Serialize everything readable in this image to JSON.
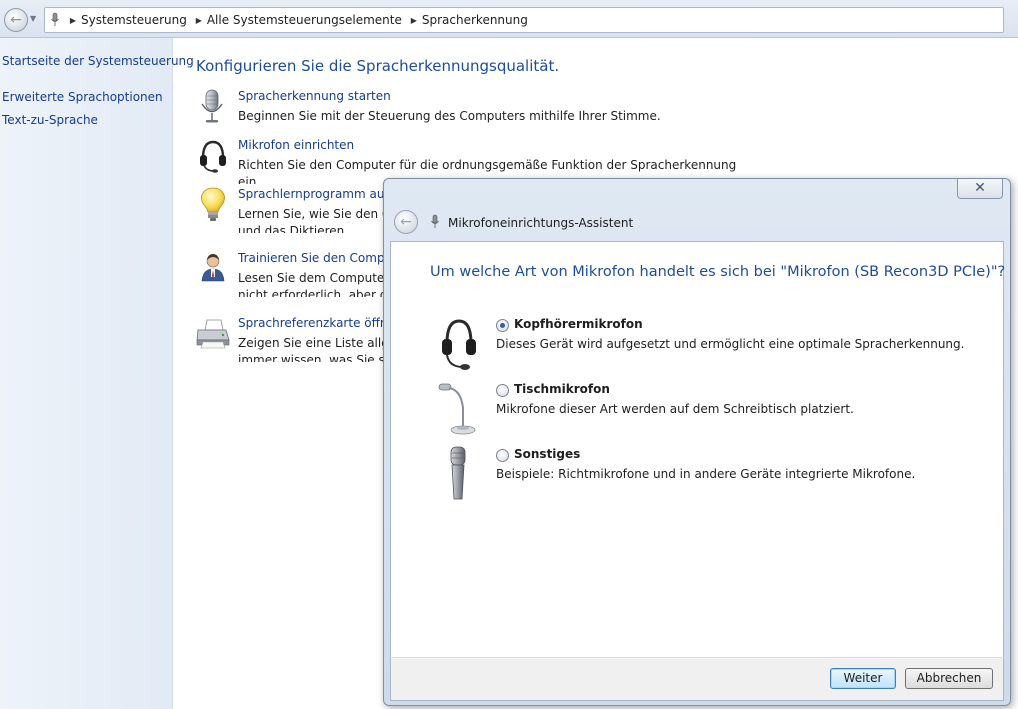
{
  "address_bar": {
    "crumbs": [
      "Systemsteuerung",
      "Alle Systemsteuerungselemente",
      "Spracherkennung"
    ]
  },
  "left_pane": {
    "home_link": "Startseite der Systemsteuerung",
    "links": [
      "Erweiterte Sprachoptionen",
      "Text-zu-Sprache"
    ]
  },
  "main": {
    "title": "Konfigurieren Sie die Spracherkennungsqualität.",
    "tasks": [
      {
        "link": "Spracherkennung starten",
        "desc": "Beginnen Sie mit der Steuerung des Computers mithilfe Ihrer Stimme."
      },
      {
        "link": "Mikrofon einrichten",
        "desc": "Richten Sie den Computer für die ordnungsgemäße Funktion der Spracherkennung ein."
      },
      {
        "link": "Sprachlernprogramm ausfü",
        "desc_line1": "Lernen Sie, wie Sie den Com",
        "desc_line2": "und das Diktieren."
      },
      {
        "link": "Trainieren Sie den Compute",
        "desc_line1": "Lesen Sie dem Computer Te",
        "desc_line2": "nicht erforderlich, aber die C"
      },
      {
        "link": "Sprachreferenzkarte öffnen",
        "desc_line1": "Zeigen Sie eine Liste allgem",
        "desc_line2": "immer wissen, was Sie sage"
      }
    ]
  },
  "dialog": {
    "title": "Mikrofoneinrichtungs-Assistent",
    "close_glyph": "✕",
    "question": "Um welche Art von Mikrofon handelt es sich bei \"Mikrofon (SB Recon3D PCIe)\"?",
    "options": [
      {
        "label": "Kopfhörermikrofon",
        "desc": "Dieses Gerät wird aufgesetzt und ermöglicht eine optimale Spracherkennung.",
        "checked": true
      },
      {
        "label": "Tischmikrofon",
        "desc": "Mikrofone dieser Art werden auf dem Schreibtisch platziert.",
        "checked": false
      },
      {
        "label": "Sonstiges",
        "desc": "Beispiele: Richtmikrofone und in andere Geräte integrierte Mikrofone.",
        "checked": false
      }
    ],
    "buttons": {
      "next": "Weiter",
      "cancel": "Abbrechen"
    }
  },
  "icons": {
    "back": "back-arrow-icon",
    "microphone": "microphone-icon",
    "headset": "headset-icon",
    "bulb": "light-bulb-icon",
    "trainer": "person-icon",
    "printer": "printer-icon",
    "desk_mic": "desk-microphone-icon",
    "handheld_mic": "handheld-microphone-icon"
  }
}
